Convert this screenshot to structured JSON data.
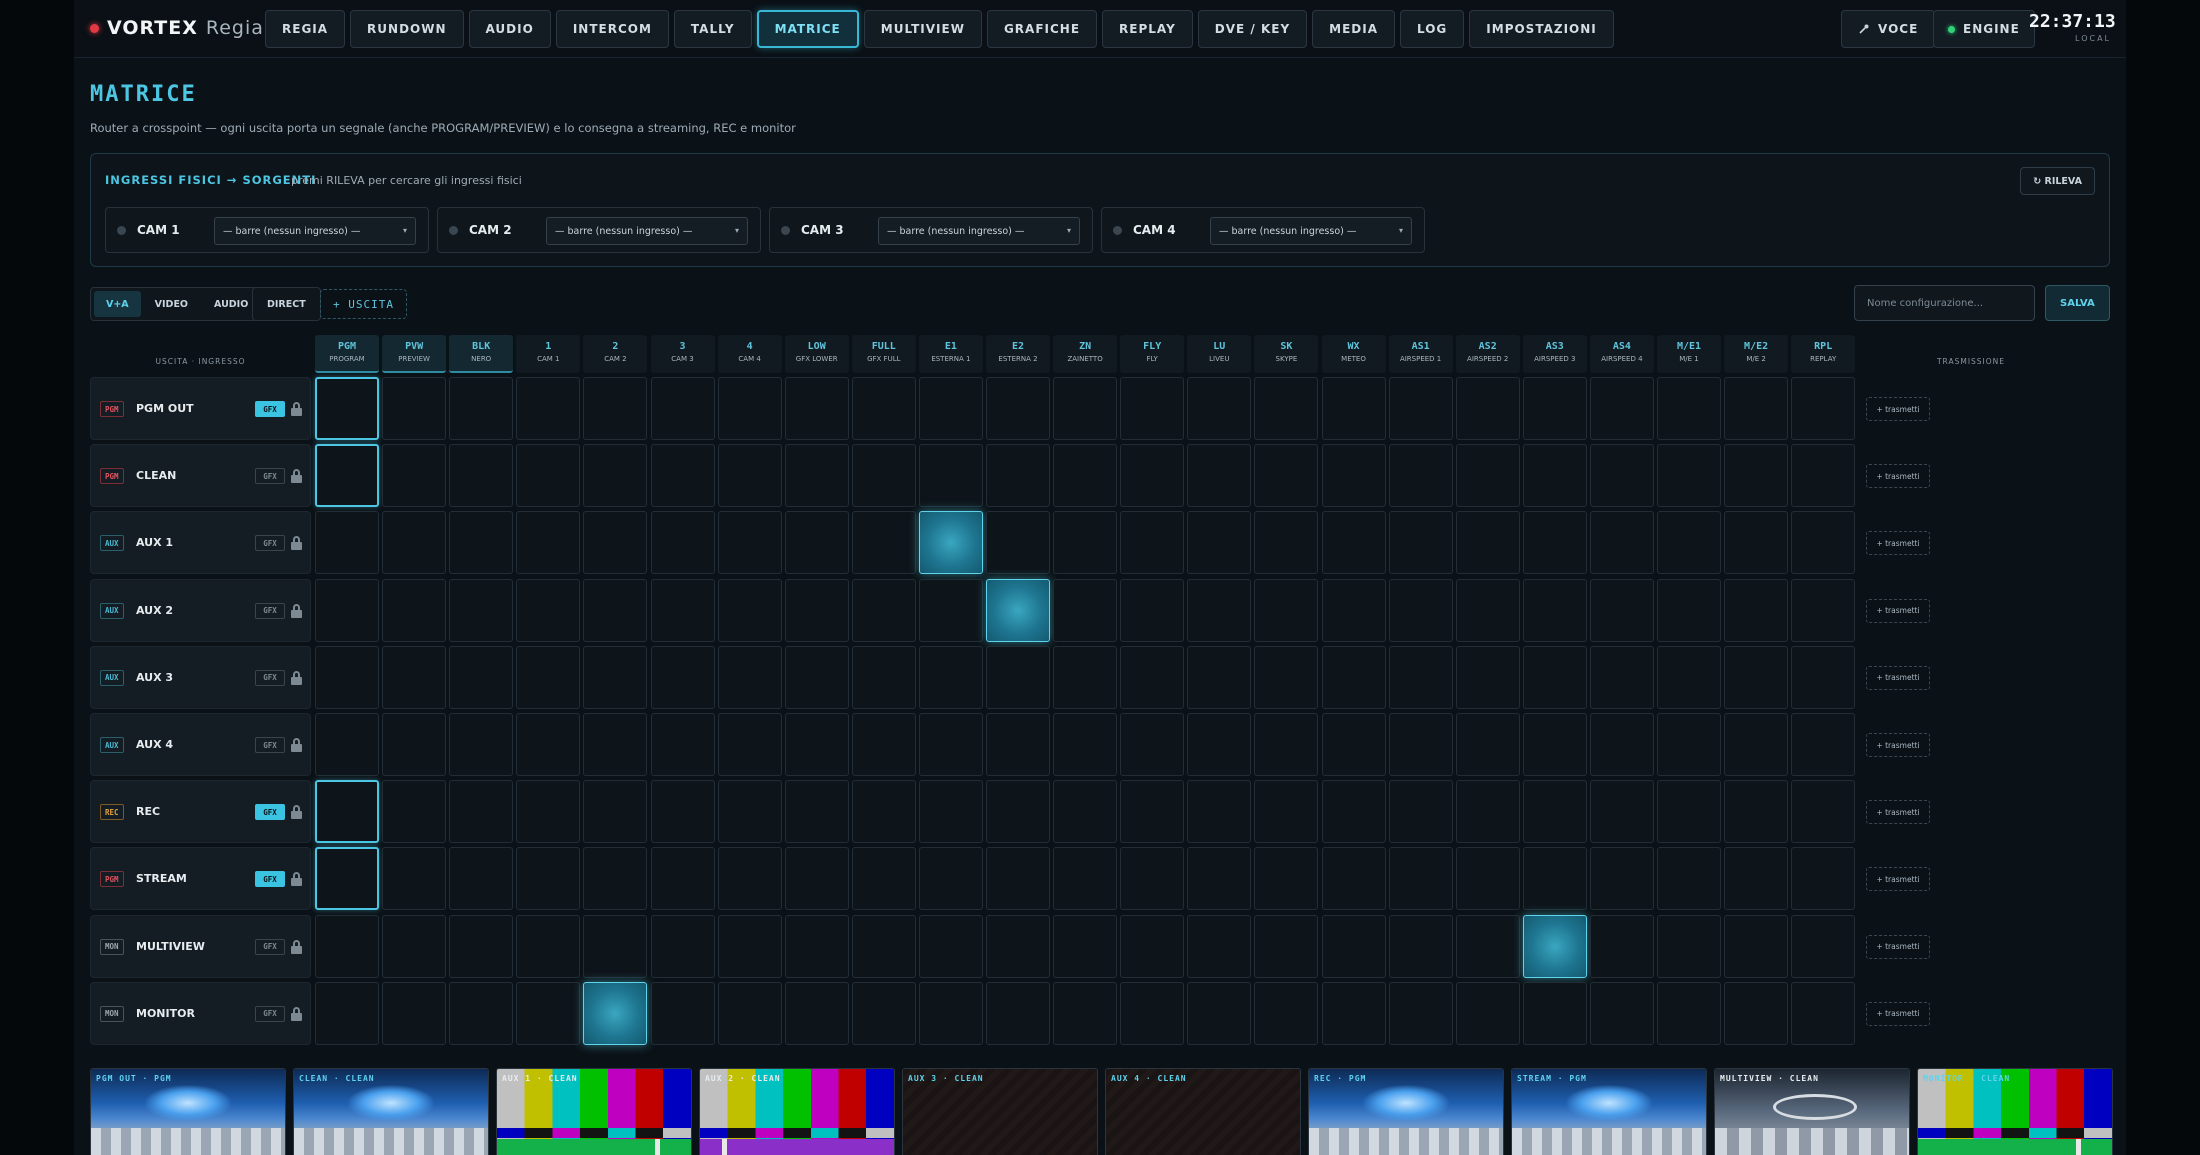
{
  "brand": {
    "name": "VORTEX",
    "subtitle": "Regia"
  },
  "nav": {
    "tabs": [
      "REGIA",
      "RUNDOWN",
      "AUDIO",
      "INTERCOM",
      "TALLY",
      "MATRICE",
      "MULTIVIEW",
      "GRAFICHE",
      "REPLAY",
      "DVE / KEY",
      "MEDIA",
      "LOG",
      "IMPOSTAZIONI"
    ],
    "active": "MATRICE"
  },
  "header": {
    "voice_label": "VOCE",
    "engine_label": "ENGINE",
    "clock_time": "22:37:13",
    "clock_zone": "LOCAL"
  },
  "page": {
    "title": "MATRICE",
    "subtitle": "Router a crosspoint — ogni uscita porta un segnale (anche PROGRAM/PREVIEW) e lo consegna a streaming, REC e monitor"
  },
  "inputs_panel": {
    "title": "INGRESSI FISICI → SORGENTI",
    "hint": "premi RILEVA per cercare gli ingressi fisici",
    "detect_label": "↻ RILEVA",
    "cams": [
      {
        "name": "CAM 1",
        "selected": "— barre (nessun ingresso) —"
      },
      {
        "name": "CAM 2",
        "selected": "— barre (nessun ingresso) —"
      },
      {
        "name": "CAM 3",
        "selected": "— barre (nessun ingresso) —"
      },
      {
        "name": "CAM 4",
        "selected": "— barre (nessun ingresso) —"
      }
    ]
  },
  "toolbar": {
    "modes": [
      "V+A",
      "VIDEO",
      "AUDIO"
    ],
    "active_mode": "V+A",
    "direct_label": "DIRECT",
    "add_output_label": "+ USCITA",
    "config_placeholder": "Nome configurazione...",
    "save_label": "SALVA"
  },
  "matrix": {
    "corner_label": "USCITA · INGRESSO",
    "transmit_header": "TRASMISSIONE",
    "transmit_label": "+ trasmetti",
    "columns": [
      {
        "code": "PGM",
        "name": "PROGRAM"
      },
      {
        "code": "PVW",
        "name": "PREVIEW"
      },
      {
        "code": "BLK",
        "name": "NERO"
      },
      {
        "code": "1",
        "name": "CAM 1"
      },
      {
        "code": "2",
        "name": "CAM 2"
      },
      {
        "code": "3",
        "name": "CAM 3"
      },
      {
        "code": "4",
        "name": "CAM 4"
      },
      {
        "code": "LOW",
        "name": "GFX LOWER"
      },
      {
        "code": "FULL",
        "name": "GFX FULL"
      },
      {
        "code": "E1",
        "name": "ESTERNA 1"
      },
      {
        "code": "E2",
        "name": "ESTERNA 2"
      },
      {
        "code": "ZN",
        "name": "ZAINETTO"
      },
      {
        "code": "FLY",
        "name": "FLY"
      },
      {
        "code": "LU",
        "name": "LIVEU"
      },
      {
        "code": "SK",
        "name": "SKYPE"
      },
      {
        "code": "WX",
        "name": "METEO"
      },
      {
        "code": "AS1",
        "name": "AIRSPEED 1"
      },
      {
        "code": "AS2",
        "name": "AIRSPEED 2"
      },
      {
        "code": "AS3",
        "name": "AIRSPEED 3"
      },
      {
        "code": "AS4",
        "name": "AIRSPEED 4"
      },
      {
        "code": "M/E1",
        "name": "M/E 1"
      },
      {
        "code": "M/E2",
        "name": "M/E 2"
      },
      {
        "code": "RPL",
        "name": "REPLAY"
      }
    ],
    "rows": [
      {
        "tag": "PGM",
        "kind": "pgm",
        "name": "PGM OUT",
        "gfx": true,
        "routed_col": 0,
        "active_col": null
      },
      {
        "tag": "PGM",
        "kind": "pgm",
        "name": "CLEAN",
        "gfx": false,
        "routed_col": 0,
        "active_col": null
      },
      {
        "tag": "AUX",
        "kind": "aux",
        "name": "AUX 1",
        "gfx": false,
        "routed_col": null,
        "active_col": 9
      },
      {
        "tag": "AUX",
        "kind": "aux",
        "name": "AUX 2",
        "gfx": false,
        "routed_col": null,
        "active_col": 10
      },
      {
        "tag": "AUX",
        "kind": "aux",
        "name": "AUX 3",
        "gfx": false,
        "routed_col": null,
        "active_col": null
      },
      {
        "tag": "AUX",
        "kind": "aux",
        "name": "AUX 4",
        "gfx": false,
        "routed_col": null,
        "active_col": null
      },
      {
        "tag": "REC",
        "kind": "rec",
        "name": "REC",
        "gfx": true,
        "routed_col": 0,
        "active_col": null
      },
      {
        "tag": "PGM",
        "kind": "pgm",
        "name": "STREAM",
        "gfx": true,
        "routed_col": 0,
        "active_col": null
      },
      {
        "tag": "MON",
        "kind": "mon",
        "name": "MULTIVIEW",
        "gfx": false,
        "routed_col": null,
        "active_col": 18
      },
      {
        "tag": "MON",
        "kind": "mon",
        "name": "MONITOR",
        "gfx": false,
        "routed_col": null,
        "active_col": 4
      }
    ],
    "gfx_label": "GFX"
  },
  "previews": [
    {
      "label": "PGM OUT · PGM",
      "kind": "studio",
      "label_color": "#5fd3ec"
    },
    {
      "label": "CLEAN · CLEAN",
      "kind": "studio",
      "label_color": "#5fd3ec"
    },
    {
      "label": "AUX 1 · CLEAN",
      "kind": "bars",
      "label_color": "#e7ecef",
      "strip_color": "#14b04a"
    },
    {
      "label": "AUX 2 · CLEAN",
      "kind": "bars",
      "label_color": "#e7ecef",
      "strip_color": "#8a2fc8"
    },
    {
      "label": "AUX 3 · CLEAN",
      "kind": "hatch",
      "label_color": "#5fd3ec"
    },
    {
      "label": "AUX 4 · CLEAN",
      "kind": "hatch",
      "label_color": "#5fd3ec"
    },
    {
      "label": "REC · PGM",
      "kind": "studio",
      "label_color": "#5fd3ec"
    },
    {
      "label": "STREAM · PGM",
      "kind": "studio",
      "label_color": "#5fd3ec"
    },
    {
      "label": "MULTIVIEW · CLEAN",
      "kind": "mvstudio",
      "label_color": "#e7ecef"
    },
    {
      "label": "MONITOR · CLEAN",
      "kind": "bars",
      "label_color": "#5fd3ec",
      "strip_color": "#14b04a"
    }
  ],
  "colors": {
    "accent": "#4cc6e2",
    "pgm": "#e05560",
    "aux": "#4bb9d2",
    "rec": "#e0a040",
    "engine_ok": "#2fd27a"
  }
}
